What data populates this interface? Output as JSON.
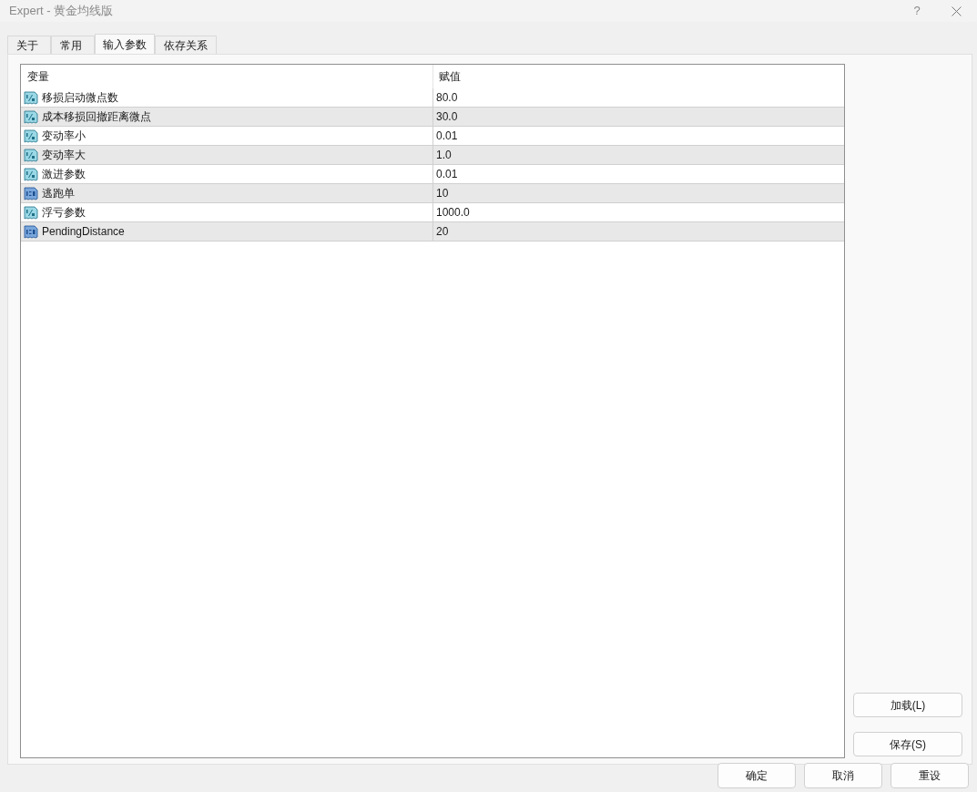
{
  "window": {
    "title": "Expert - 黄金均线版",
    "help": "?"
  },
  "tabs": [
    {
      "label": "关于",
      "selected": false
    },
    {
      "label": "常用",
      "selected": false
    },
    {
      "label": "输入参数",
      "selected": true
    },
    {
      "label": "依存关系",
      "selected": false
    }
  ],
  "table": {
    "columns": [
      "变量",
      "赋值"
    ],
    "rows": [
      {
        "kind": "double",
        "name": "移损启动微点数",
        "value": "80.0"
      },
      {
        "kind": "double",
        "name": "成本移损回撤距离微点",
        "value": "30.0"
      },
      {
        "kind": "double",
        "name": "变动率小",
        "value": "0.01"
      },
      {
        "kind": "double",
        "name": "变动率大",
        "value": "1.0"
      },
      {
        "kind": "double",
        "name": "激进参数",
        "value": "0.01"
      },
      {
        "kind": "int",
        "name": "逃跑单",
        "value": "10"
      },
      {
        "kind": "double",
        "name": "浮亏参数",
        "value": "1000.0"
      },
      {
        "kind": "int",
        "name": "PendingDistance",
        "value": "20"
      }
    ]
  },
  "side_buttons": [
    "加载(L)",
    "保存(S)"
  ],
  "footer_buttons": [
    "确定",
    "取消",
    "重设"
  ]
}
